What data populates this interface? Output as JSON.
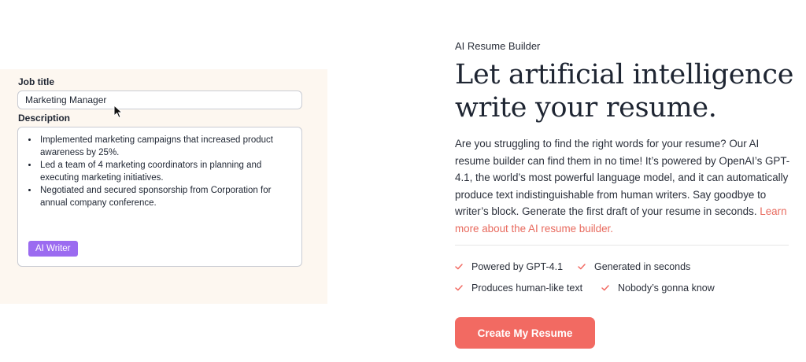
{
  "demo": {
    "job_title_label": "Job title",
    "job_title_value": "Marketing Manager",
    "description_label": "Description",
    "description_items": [
      "Implemented marketing campaigns that increased product awareness by 25%.",
      "Led a team of 4 marketing coordinators in planning and executing marketing initiatives.",
      "Negotiated and secured sponsorship from Corporation for annual company conference."
    ],
    "ai_writer_label": "AI Writer"
  },
  "hero": {
    "eyebrow": "AI Resume Builder",
    "headline": "Let artificial intelligence write your resume.",
    "body": "Are you struggling to find the right words for your resume? Our AI resume builder can find them in no time! It’s powered by OpenAI’s GPT-4.1, the world’s most powerful language model, and it can automatically produce text indistinguishable from human writers. Say goodbye to writer’s block. Generate the first draft of your resume in seconds. ",
    "link_text": "Learn more about the AI resume builder."
  },
  "features": [
    "Powered by GPT-4.1",
    "Generated in seconds",
    "Produces human-like text",
    "Nobody’s gonna know"
  ],
  "cta_label": "Create My Resume",
  "colors": {
    "accent": "#f26a62",
    "link": "#e86a5e",
    "ai_writer": "#9b6bf0",
    "panel_bg": "#fdf7f0"
  }
}
